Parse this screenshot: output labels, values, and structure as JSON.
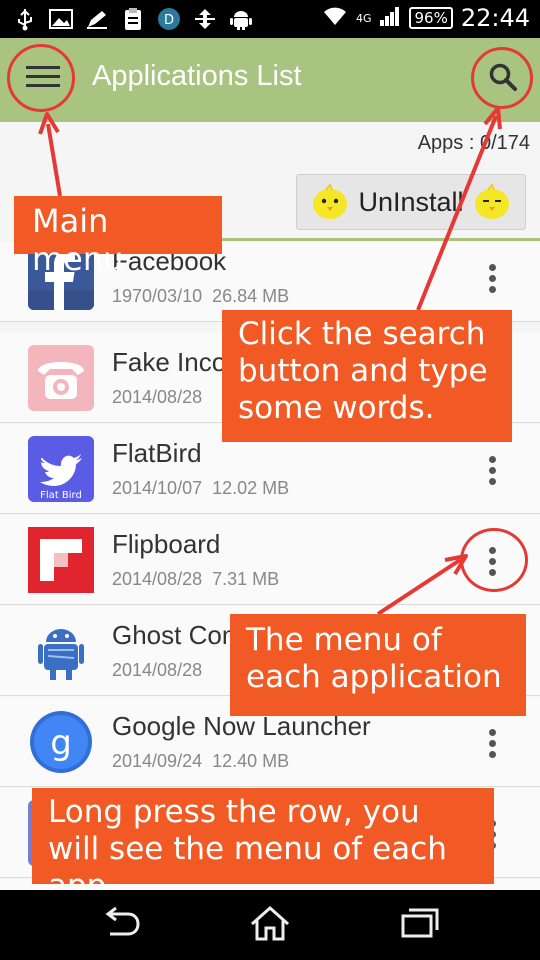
{
  "status_bar": {
    "network": "4G",
    "battery": "96%",
    "time": "22:44",
    "icons": [
      "usb-icon",
      "image-icon",
      "pen-icon",
      "clipboard-icon",
      "pay-icon",
      "transfer-icon",
      "android-icon",
      "wifi-icon",
      "signal-icon",
      "battery-icon"
    ]
  },
  "toolbar": {
    "title": "Applications List",
    "menu_icon": "hamburger-icon",
    "search_icon": "search-icon",
    "color": "#a9c381"
  },
  "header": {
    "apps_count": "Apps : 0/174",
    "uninstall_label": "UnInstall"
  },
  "apps": [
    {
      "name": "Facebook",
      "date": "1970/03/10",
      "size": "26.84 MB",
      "icon": "facebook-icon"
    },
    {
      "name": "Fake Incoming Call",
      "date": "2014/08/28",
      "size": "",
      "icon": "fake-call-icon"
    },
    {
      "name": "FlatBird",
      "date": "2014/10/07",
      "size": "12.02 MB",
      "icon": "flatbird-icon"
    },
    {
      "name": "Flipboard",
      "date": "2014/08/28",
      "size": "7.31 MB",
      "icon": "flipboard-icon"
    },
    {
      "name": "Ghost Commander",
      "date": "2014/08/28",
      "size": "",
      "icon": "ghost-android-icon"
    },
    {
      "name": "Google Now Launcher",
      "date": "2014/09/24",
      "size": "12.40 MB",
      "icon": "google-icon"
    },
    {
      "name": "",
      "date": "",
      "size": "",
      "icon": "partial-app-icon"
    }
  ],
  "annotations": {
    "main_menu": "Main menu",
    "search": "Click the search button and type some words.",
    "app_menu": "The menu of each application",
    "long_press": "Long press the row,  you will see the menu of each app",
    "color": "#f15a24",
    "ring_color": "#e53935"
  },
  "nav_bar": {
    "icons": [
      "back-icon",
      "home-icon",
      "recents-icon"
    ]
  }
}
